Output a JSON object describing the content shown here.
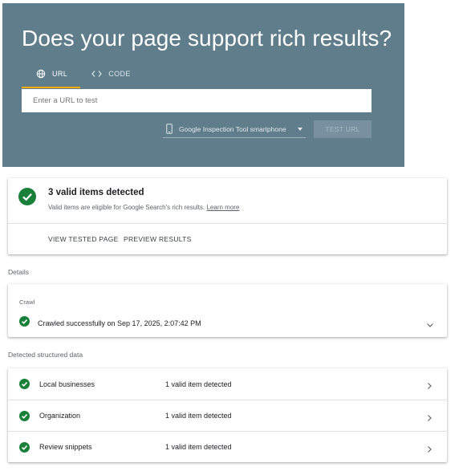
{
  "hero": {
    "title": "Does your page support rich results?",
    "tabs": [
      {
        "label": "URL",
        "icon": "globe-icon",
        "active": true
      },
      {
        "label": "CODE",
        "icon": "code-icon",
        "active": false
      }
    ],
    "url_placeholder": "Enter a URL to test",
    "url_value": "",
    "device": {
      "selected": "Google Inspection Tool smartphone",
      "icon": "smartphone-icon"
    },
    "test_button_label": "TEST URL"
  },
  "summary": {
    "title": "3 valid items detected",
    "subtitle": "Valid items are eligible for Google Search's rich results.",
    "learn_more": "Learn more",
    "actions": [
      "VIEW TESTED PAGE",
      "PREVIEW RESULTS"
    ]
  },
  "details": {
    "label": "Details",
    "crawl": {
      "heading": "Crawl",
      "status": "Crawled successfully on Sep 17, 2025, 2:07:42 PM"
    }
  },
  "structured": {
    "label": "Detected structured data",
    "items": [
      {
        "name": "Local businesses",
        "count": "1 valid item detected"
      },
      {
        "name": "Organization",
        "count": "1 valid item detected"
      },
      {
        "name": "Review snippets",
        "count": "1 valid item detected"
      }
    ]
  },
  "colors": {
    "hero_bg": "#607d8b",
    "tab_indicator": "#f9ab00",
    "success": "#188038"
  }
}
